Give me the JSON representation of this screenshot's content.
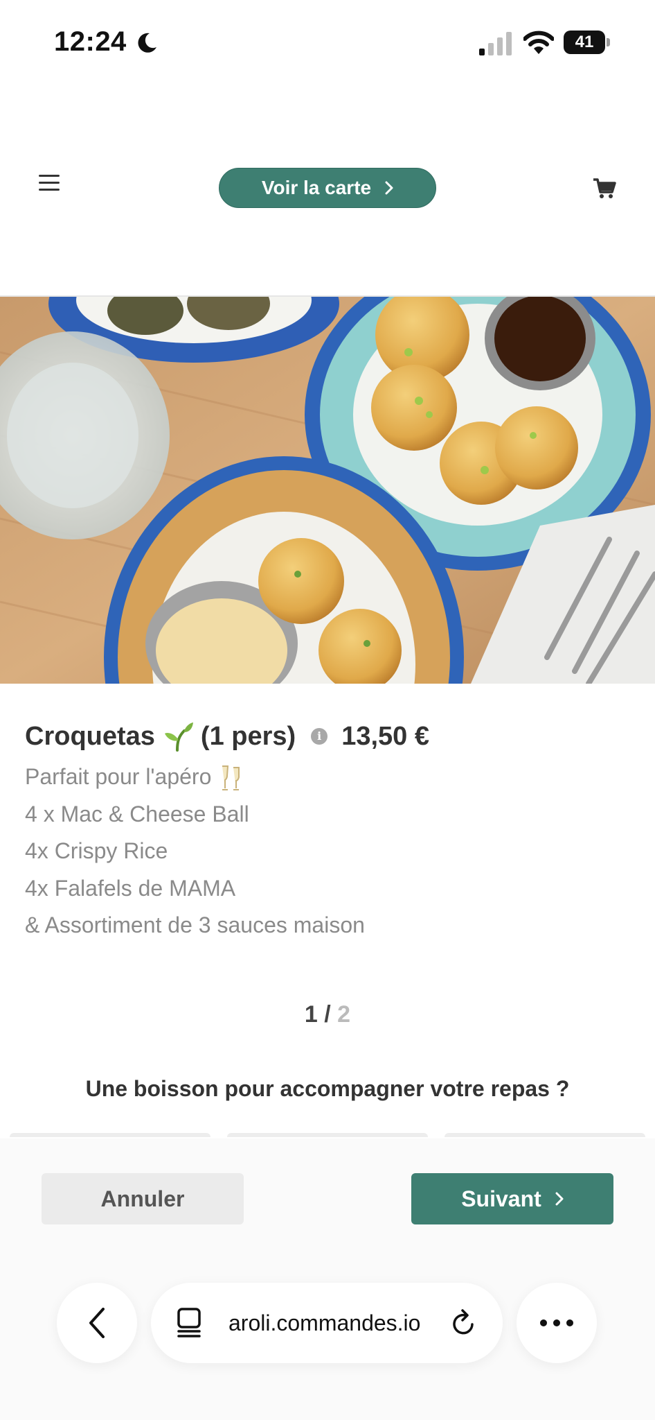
{
  "status_bar": {
    "time": "12:24",
    "battery": "41",
    "battery_level": 0.41,
    "icons": [
      "moon-icon",
      "cellular-signal-icon",
      "wifi-icon",
      "battery-icon"
    ]
  },
  "header": {
    "menu_icon": "hamburger-menu-icon",
    "cta_label": "Voir la carte",
    "cart_icon": "shopping-cart-icon"
  },
  "product": {
    "name": "Croquetas",
    "name_emoji": "sprout-emoji",
    "persons": "(1 pers)",
    "info_icon": "i",
    "price": "13,50 €",
    "description": [
      "Parfait pour l'apéro",
      "4 x Mac & Cheese Ball",
      "4x Crispy Rice",
      "4x Falafels de MAMA",
      "& Assortiment de 3 sauces maison"
    ]
  },
  "pager": {
    "current": "1",
    "separator": " / ",
    "total": "2"
  },
  "drink_question": "Une boisson pour accompagner votre repas ?",
  "actions": {
    "cancel_label": "Annuler",
    "next_label": "Suivant"
  },
  "browser": {
    "url": "aroli.commandes.io",
    "icons": [
      "back-arrow-icon",
      "tabs-icon",
      "reload-icon",
      "more-icon"
    ]
  },
  "colors": {
    "accent": "#3e7f72",
    "text": "#333333",
    "muted": "#8a8a8a"
  }
}
